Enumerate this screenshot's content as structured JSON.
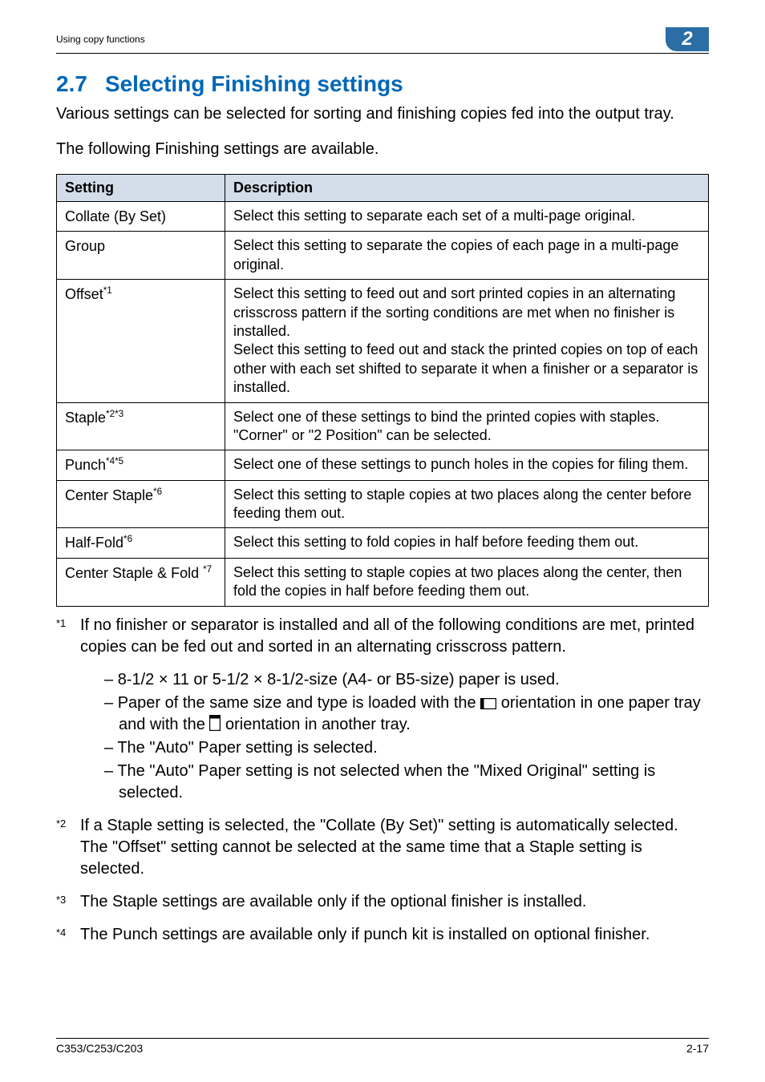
{
  "header": {
    "running_title": "Using copy functions",
    "badge": "2"
  },
  "section": {
    "number": "2.7",
    "title": "Selecting Finishing settings"
  },
  "intro_1": "Various settings can be selected for sorting and finishing copies fed into the output tray.",
  "intro_2": "The following Finishing settings are available.",
  "table": {
    "header_setting": "Setting",
    "header_description": "Description",
    "rows": [
      {
        "setting": "Collate (By Set)",
        "sup": "",
        "description": "Select this setting to separate each set of a multi-page original."
      },
      {
        "setting": "Group",
        "sup": "",
        "description": "Select this setting to separate the copies of each page in a multi-page original."
      },
      {
        "setting": "Offset",
        "sup": "*1",
        "description": "Select this setting to feed out and sort printed copies in an alternating crisscross pattern if the sorting conditions are met when no finisher is installed.\nSelect this setting to feed out and stack the printed copies on top of each other with each set shifted to separate it when a finisher or a separator is installed."
      },
      {
        "setting": "Staple",
        "sup": "*2*3",
        "description": "Select one of these settings to bind the printed copies with staples. \"Corner\" or \"2 Position\" can be selected."
      },
      {
        "setting": "Punch",
        "sup": "*4*5",
        "description": "Select one of these settings to punch holes in the copies for filing them."
      },
      {
        "setting": "Center Staple",
        "sup": "*6",
        "description": "Select this setting to staple copies at two places along the center before feeding them out."
      },
      {
        "setting": "Half-Fold",
        "sup": "*6",
        "description": "Select this setting to fold copies in half before feeding them out."
      },
      {
        "setting": "Center Staple & Fold ",
        "sup": "*7",
        "description": "Select this setting to staple copies at two places along the center, then fold the copies in half before feeding them out."
      }
    ]
  },
  "footnotes": {
    "fn1_mark": "*1",
    "fn1_text": "If no finisher or separator is installed and all of the following conditions are met, printed copies can be fed out and sorted in an alternating crisscross pattern.",
    "fn1_bullets": {
      "b1": "8-1/2 × 11 or 5-1/2 × 8-1/2-size (A4- or B5-size) paper is used.",
      "b2_a": "Paper of the same size and type is loaded with the ",
      "b2_b": " orientation in one paper tray and with the ",
      "b2_c": " orientation in another tray.",
      "b3": "The \"Auto\" Paper setting is selected.",
      "b4": "The \"Auto\" Paper setting is not selected when the \"Mixed Original\" setting is selected."
    },
    "fn2_mark": "*2",
    "fn2_text": "If a Staple setting is selected, the \"Collate (By Set)\" setting is automatically selected. The \"Offset\" setting cannot be selected at the same time that a Staple setting is selected.",
    "fn3_mark": "*3",
    "fn3_text": "The Staple settings are available only if the optional finisher is installed.",
    "fn4_mark": "*4",
    "fn4_text": "The Punch settings are available only if punch kit is installed on optional finisher."
  },
  "footer": {
    "model": "C353/C253/C203",
    "page": "2-17"
  }
}
